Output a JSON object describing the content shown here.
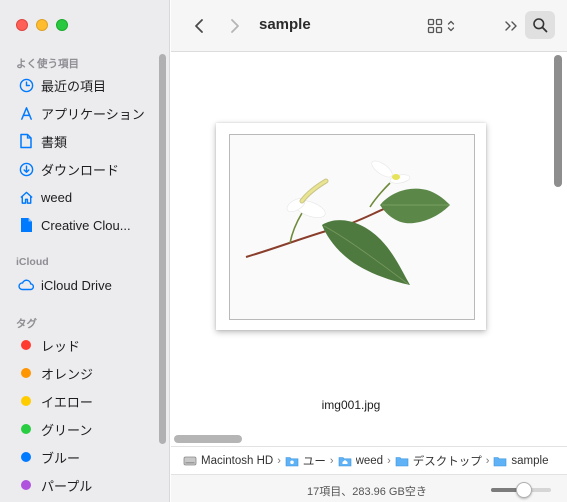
{
  "window": {
    "title": "sample"
  },
  "sidebar": {
    "sections": [
      {
        "title": "よく使う項目",
        "items": [
          {
            "label": "最近の項目",
            "icon": "clock-icon"
          },
          {
            "label": "アプリケーション",
            "icon": "applications-icon"
          },
          {
            "label": "書類",
            "icon": "document-icon"
          },
          {
            "label": "ダウンロード",
            "icon": "download-icon"
          },
          {
            "label": "weed",
            "icon": "home-icon"
          },
          {
            "label": "Creative Clou...",
            "icon": "file-icon"
          }
        ]
      },
      {
        "title": "iCloud",
        "items": [
          {
            "label": "iCloud Drive",
            "icon": "cloud-icon"
          }
        ]
      },
      {
        "title": "タグ",
        "items": [
          {
            "label": "レッド",
            "color": "#ff3b30"
          },
          {
            "label": "オレンジ",
            "color": "#ff9500"
          },
          {
            "label": "イエロー",
            "color": "#ffcc00"
          },
          {
            "label": "グリーン",
            "color": "#28cd41"
          },
          {
            "label": "ブルー",
            "color": "#007aff"
          },
          {
            "label": "パープル",
            "color": "#af52de"
          }
        ]
      }
    ]
  },
  "toolbar": {
    "back_icon": "chevron-left-icon",
    "forward_icon": "chevron-right-icon",
    "view_icon": "grid-view-icon",
    "more_icon": "double-chevron-icon",
    "search_icon": "search-icon"
  },
  "content": {
    "file": {
      "name": "img001.jpg",
      "icon": "image-thumbnail"
    }
  },
  "pathbar": {
    "items": [
      {
        "label": "Macintosh HD",
        "icon": "hard-drive-icon"
      },
      {
        "label": "ユー",
        "icon": "folder-icon"
      },
      {
        "label": "weed",
        "icon": "folder-icon"
      },
      {
        "label": "デスクトップ",
        "icon": "folder-icon"
      },
      {
        "label": "sample",
        "icon": "folder-icon"
      }
    ]
  },
  "status": {
    "text": "17項目、283.96 GB空き",
    "zoom_level": 0.55
  },
  "colors": {
    "accent": "#007aff",
    "sidebar_bg": "#ecebee",
    "toolbar_bg": "#f6f6f6"
  }
}
